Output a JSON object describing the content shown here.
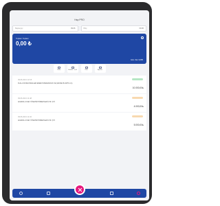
{
  "app": {
    "title": "Hap PRO"
  },
  "filters": {
    "start": {
      "label": "Başlangıç",
      "value": "09.06"
    },
    "end": {
      "label": "Bitiş",
      "value": "09.06"
    }
  },
  "balance": {
    "label": "Toplam Toplam",
    "amount": "0,00 ₺",
    "limit": "Gün. Kal. 9.085"
  },
  "actions": [
    {
      "label": "Yükle",
      "icon": "card-icon"
    },
    {
      "label": "Gönder / Çek",
      "icon": "transfer-icon"
    },
    {
      "label": "Öde",
      "icon": "pay-icon"
    },
    {
      "label": "Ayarlar",
      "icon": "settings-icon"
    }
  ],
  "transactions": [
    {
      "date": "09.06.2021 12:15",
      "description": "KULLU DÜZGÜNGİLLER ENERJİ MADENCİLİK VE ÇEVRE PLASTİK A.Ş.",
      "amount": "10.000,00₺",
      "badge_color": "#b5e6c4"
    },
    {
      "date": "09.06.2021 11:48",
      "description": "ANADOLU KAR YÖNETİM HİZMETLERİ LTD. ŞTİ.",
      "amount": "4.000,00₺",
      "badge_color": "#f8d9b0"
    },
    {
      "date": "09.06.2021 11:32",
      "description": "ANADOLU KAR YÖNETİM HİZMETLERİ LTD. ŞTİ.",
      "amount": "5.000,00₺",
      "badge_color": "#f8d9b0"
    }
  ],
  "colors": {
    "primary": "#1f47a4",
    "accent": "#e5177e"
  },
  "tabbar": {
    "tabs": [
      {
        "icon": "home-icon"
      },
      {
        "icon": "wallet-icon"
      },
      {
        "icon": "qr-icon"
      },
      {
        "icon": "bank-icon"
      },
      {
        "icon": "profile-icon"
      }
    ]
  }
}
